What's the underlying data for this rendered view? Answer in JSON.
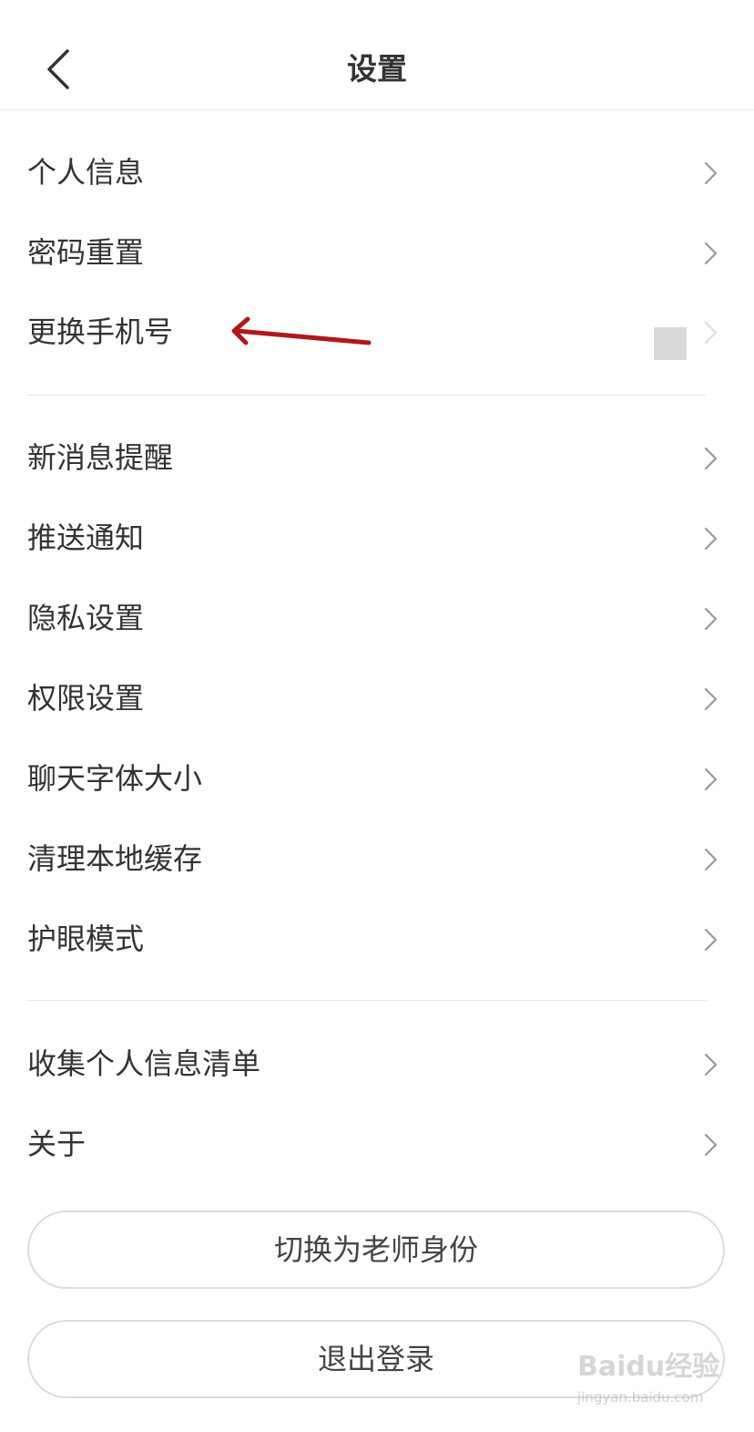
{
  "header": {
    "title": "设置",
    "back_icon": "chevron-left-icon"
  },
  "section1": {
    "items": [
      {
        "label": "个人信息"
      },
      {
        "label": "密码重置"
      },
      {
        "label": "更换手机号"
      }
    ]
  },
  "section2": {
    "items": [
      {
        "label": "新消息提醒"
      },
      {
        "label": "推送通知"
      },
      {
        "label": "隐私设置"
      },
      {
        "label": "权限设置"
      },
      {
        "label": "聊天字体大小"
      },
      {
        "label": "清理本地缓存"
      },
      {
        "label": "护眼模式"
      }
    ]
  },
  "section3": {
    "items": [
      {
        "label": "收集个人信息清单"
      },
      {
        "label": "关于"
      }
    ]
  },
  "buttons": {
    "switch_role": "切换为老师身份",
    "logout": "退出登录"
  },
  "watermark": {
    "logo": "Baidu经验",
    "url": "jingyan.baidu.com"
  },
  "colors": {
    "annotation_arrow": "#b0181a",
    "chevron": "#999999",
    "divider": "#e8e8e8"
  }
}
